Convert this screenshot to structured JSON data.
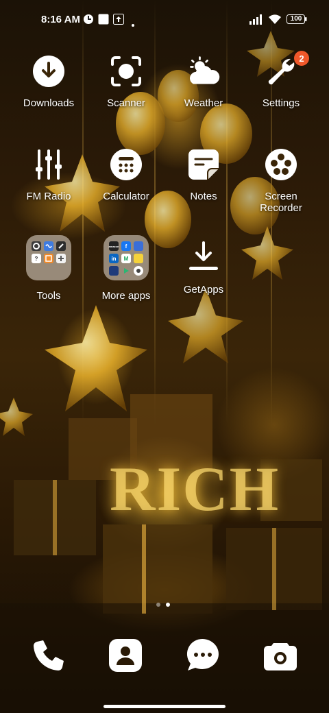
{
  "status_bar": {
    "time": "8:16 AM",
    "battery": "100",
    "icons": [
      "notification-icon",
      "image-icon",
      "upload-icon",
      "dot-icon",
      "signal-icon",
      "wifi-icon",
      "battery-icon"
    ]
  },
  "wallpaper": {
    "text": "RICH"
  },
  "apps": [
    {
      "label": "Downloads",
      "icon": "download-icon"
    },
    {
      "label": "Scanner",
      "icon": "scanner-icon"
    },
    {
      "label": "Weather",
      "icon": "weather-icon"
    },
    {
      "label": "Settings",
      "icon": "wrench-icon",
      "badge": "2"
    },
    {
      "label": "FM Radio",
      "icon": "equalizer-icon"
    },
    {
      "label": "Calculator",
      "icon": "calculator-icon"
    },
    {
      "label": "Notes",
      "icon": "notes-icon"
    },
    {
      "label": "Screen Recorder",
      "label_line1": "Screen",
      "label_line2": "Recorder",
      "icon": "film-reel-icon"
    },
    {
      "label": "Tools",
      "icon": "folder"
    },
    {
      "label": "More apps",
      "icon": "folder"
    },
    {
      "label": "GetApps",
      "icon": "getapps-icon"
    }
  ],
  "more_apps_folder": {
    "amazon_label": "amazon"
  },
  "pager": {
    "pages": 2,
    "current": 2
  },
  "dock": [
    {
      "name": "phone-icon"
    },
    {
      "name": "contacts-icon"
    },
    {
      "name": "messages-icon"
    },
    {
      "name": "camera-icon"
    }
  ],
  "colors": {
    "badge": "#f0582a",
    "icon": "#ffffff"
  }
}
